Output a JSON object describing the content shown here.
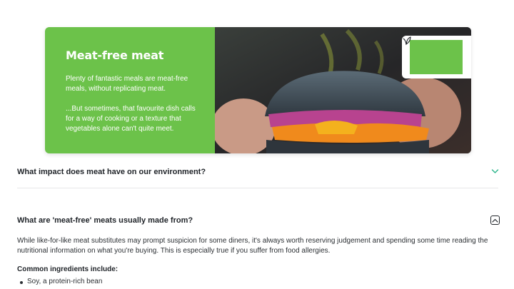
{
  "hero": {
    "title": "Meat-free meat",
    "paragraph1": "Plenty of fantastic meals are meat-free meals, without replicating meat.",
    "paragraph2": "...But sometimes, that favourite dish calls for a way of cooking or a texture that vegetables alone can't quite meet.",
    "bg_color": "#6cc24a",
    "logo_icon": "leaf-logo-icon"
  },
  "faq": [
    {
      "question": "What impact does meat have on our environment?",
      "expanded": false,
      "icon": "chevron-down-icon"
    },
    {
      "question": "What are 'meat-free' meats usually made from?",
      "expanded": true,
      "icon": "chevron-up-box-icon",
      "answer": "While like-for-like meat substitutes may prompt suspicion for some diners, it's always worth reserving judgement and spending some time reading the nutritional information on what you're buying. This is especially true if you suffer from food allergies."
    }
  ],
  "ingredients": {
    "heading": "Common ingredients include:",
    "items": [
      "Soy, a protein-rich bean"
    ]
  },
  "colors": {
    "accent": "#6cc24a",
    "chevron": "#2bb58a",
    "text": "#1f2328"
  }
}
